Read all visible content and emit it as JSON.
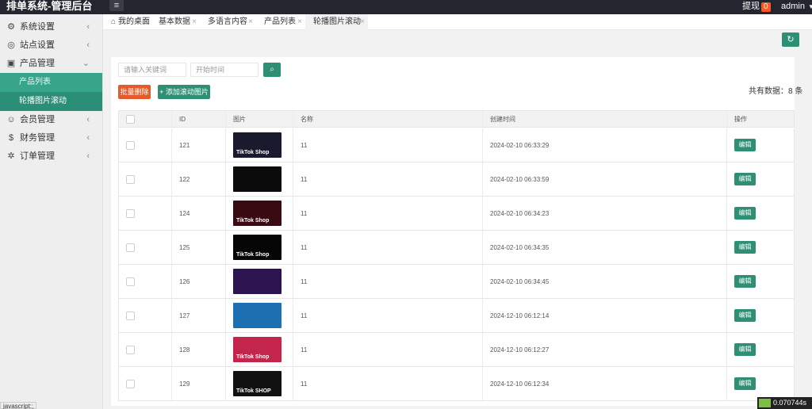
{
  "app": {
    "title": "排单系统-管理后台",
    "menu_icon": "menu-icon"
  },
  "header": {
    "remind_label": "提现",
    "remind_count": "0",
    "user": "admin"
  },
  "sidebar": {
    "items": [
      {
        "label": "系统设置",
        "icon": "gear-icon"
      },
      {
        "label": "站点设置",
        "icon": "globe-icon"
      },
      {
        "label": "产品管理",
        "icon": "box-icon"
      }
    ],
    "sub_items": [
      {
        "label": "产品列表"
      },
      {
        "label": "轮播图片滚动"
      }
    ],
    "items_after": [
      {
        "label": "会员管理",
        "icon": "user-icon"
      },
      {
        "label": "财务管理",
        "icon": "dollar-icon"
      },
      {
        "label": "订单管理",
        "icon": "settings-icon"
      }
    ]
  },
  "tabs": [
    {
      "label": "我的桌面"
    },
    {
      "label": "基本数据"
    },
    {
      "label": "多语言内容"
    },
    {
      "label": "产品列表"
    },
    {
      "label": "轮播图片滚动"
    }
  ],
  "search": {
    "keyword_placeholder": "请输入关键词",
    "time_placeholder": "开始时间"
  },
  "toolbar": {
    "batch_delete": "批量删除",
    "add_label": "添加滚动图片",
    "total_text": "共有数据：8 条"
  },
  "table": {
    "columns": [
      "",
      "ID",
      "图片",
      "名称",
      "创建时间",
      "操作"
    ],
    "rows": [
      {
        "id": "121",
        "name": "11",
        "created": "2024-02-10 06:33:29",
        "thumb": "TikTok Shop",
        "color": "#1a1a2e"
      },
      {
        "id": "122",
        "name": "11",
        "created": "2024-02-10 06:33:59",
        "thumb": "",
        "color": "#0b0b0b"
      },
      {
        "id": "124",
        "name": "11",
        "created": "2024-02-10 06:34:23",
        "thumb": "TikTok Shop",
        "color": "#3a0a12"
      },
      {
        "id": "125",
        "name": "11",
        "created": "2024-02-10 06:34:35",
        "thumb": "TikTok Shop",
        "color": "#050505"
      },
      {
        "id": "126",
        "name": "11",
        "created": "2024-02-10 06:34:45",
        "thumb": "",
        "color": "#2b1450"
      },
      {
        "id": "127",
        "name": "11",
        "created": "2024-12-10 06:12:14",
        "thumb": "",
        "color": "#1c6fb0"
      },
      {
        "id": "128",
        "name": "11",
        "created": "2024-12-10 06:12:27",
        "thumb": "TikTok Shop",
        "color": "#c4254a"
      },
      {
        "id": "129",
        "name": "11",
        "created": "2024-12-10 06:12:34",
        "thumb": "TikTok SHOP",
        "color": "#111111"
      }
    ],
    "edit_label": "编辑"
  },
  "status": {
    "js": "javascript:;",
    "timing": "0.070744s"
  }
}
